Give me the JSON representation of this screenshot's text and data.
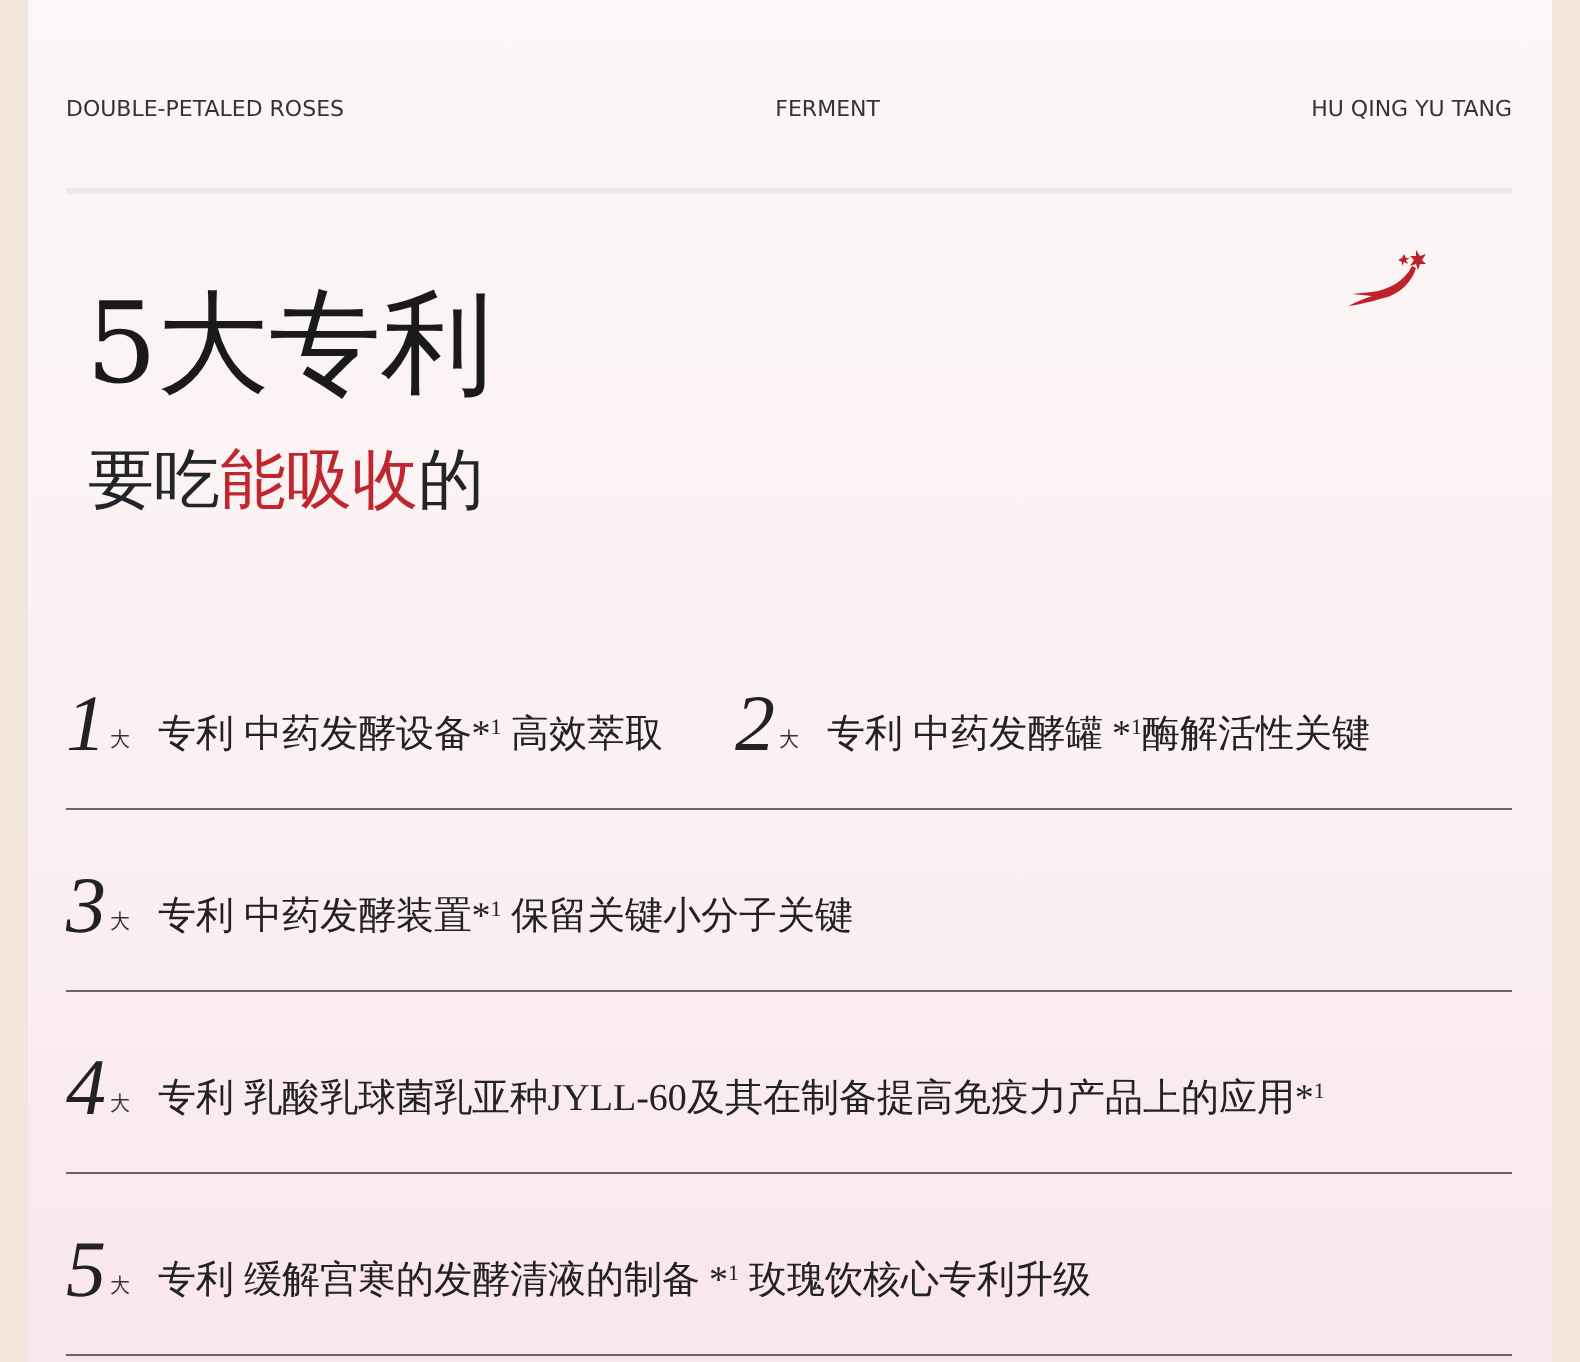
{
  "header": {
    "left": "DOUBLE-PETALED ROSES",
    "center": "FERMENT",
    "right": "HU QING YU TANG"
  },
  "title": "5大专利",
  "subtitle": [
    {
      "text": "要吃",
      "highlight": false
    },
    {
      "text": "能吸收",
      "highlight": true
    },
    {
      "text": "的",
      "highlight": false
    }
  ],
  "patent_rows": [
    {
      "items": [
        {
          "number": "1",
          "unit": "大",
          "text": "专利 中药发酵设备*$^{1}$ 高效萃取"
        },
        {
          "number": "2",
          "unit": "大",
          "text": "专利 中药发酵罐 *$^{1}$酶解活性关键"
        }
      ]
    },
    {
      "items": [
        {
          "number": "3",
          "unit": "大",
          "text": "专利 中药发酵装置*$^{1}$ 保留关键小分子关键"
        }
      ]
    },
    {
      "items": [
        {
          "number": "4",
          "unit": "大",
          "text": "专利 乳酸乳球菌乳亚种JYLL-60及其在制备提高免疫力产品上的应用*$^{1}$"
        }
      ]
    },
    {
      "items": [
        {
          "number": "5",
          "unit": "大",
          "text": "专利 缓解宫寒的发酵清液的制备 *$^{1}$ 玫瑰饮核心专利升级"
        }
      ]
    }
  ]
}
